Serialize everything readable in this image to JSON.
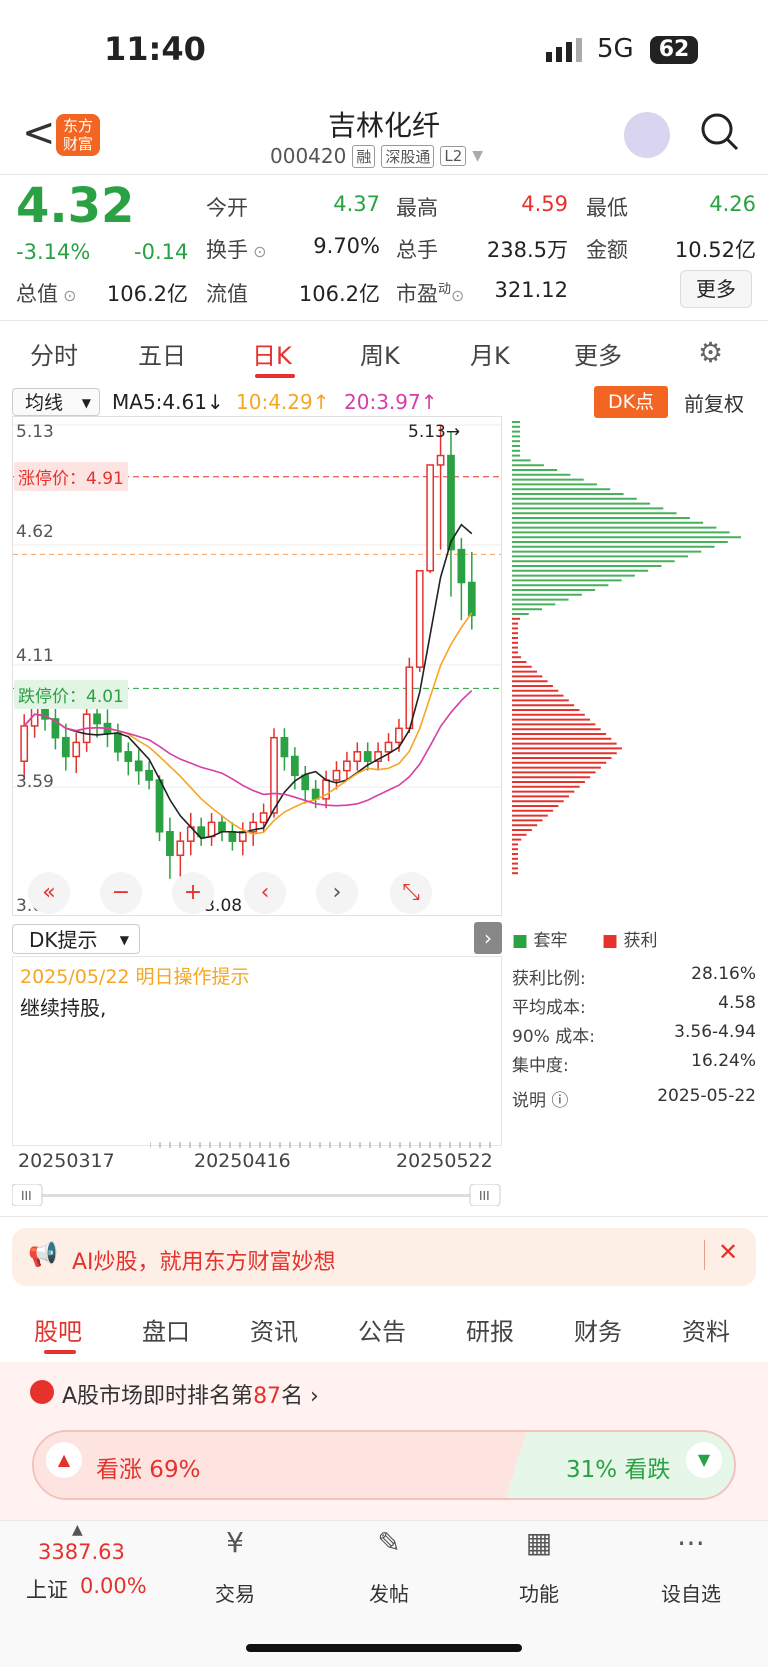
{
  "status": {
    "time": "11:40",
    "network": "5G",
    "battery": "62"
  },
  "header": {
    "back": "<",
    "logo": "东方财富",
    "title": "吉林化纤",
    "code": "000420",
    "tags": [
      "融",
      "深股通",
      "L2"
    ]
  },
  "quote": {
    "price": "4.32",
    "change_pct": "-3.14%",
    "change": "-0.14",
    "fields": [
      {
        "label": "今开",
        "value": "4.37",
        "color": "#2aa142"
      },
      {
        "label": "最高",
        "value": "4.59",
        "color": "#e5322d"
      },
      {
        "label": "最低",
        "value": "4.26",
        "color": "#2aa142"
      },
      {
        "label": "换手",
        "value": "9.70%",
        "color": "#222"
      },
      {
        "label": "总手",
        "value": "238.5万",
        "color": "#222"
      },
      {
        "label": "金额",
        "value": "10.52亿",
        "color": "#222"
      },
      {
        "label": "总值",
        "value": "106.2亿",
        "color": "#222"
      },
      {
        "label": "流值",
        "value": "106.2亿",
        "color": "#222"
      },
      {
        "label": "市盈动",
        "value": "321.12",
        "color": "#222"
      }
    ],
    "more": "更多"
  },
  "ktabs": [
    "分时",
    "五日",
    "日K",
    "周K",
    "月K",
    "更多"
  ],
  "chart_header": {
    "select": "均线",
    "ma5": "MA5:4.61↓",
    "ma10": "10:4.29↑",
    "ma20": "20:3.97↑",
    "dk": "DK点",
    "fq": "前复权"
  },
  "chart_data": {
    "type": "candlestick",
    "y_axis_labels": [
      "5.13",
      "4.62",
      "4.11",
      "3.59",
      "3.08"
    ],
    "limit_up": "涨停价：4.91",
    "limit_down": "跌停价：4.01",
    "high_mark": "5.13→",
    "low_mark": "←3.08",
    "ylim": [
      3.08,
      5.13
    ],
    "x_labels": [
      "20250317",
      "20250416",
      "20250522"
    ],
    "ma": {
      "MA5": 4.61,
      "MA10": 4.29,
      "MA20": 3.97
    },
    "candles": [
      [
        3.7,
        3.85,
        3.62,
        3.9
      ],
      [
        3.85,
        3.95,
        3.8,
        4.02
      ],
      [
        3.95,
        3.88,
        3.83,
        4.0
      ],
      [
        3.88,
        3.8,
        3.75,
        3.93
      ],
      [
        3.8,
        3.72,
        3.66,
        3.86
      ],
      [
        3.72,
        3.78,
        3.65,
        3.82
      ],
      [
        3.78,
        3.9,
        3.74,
        3.98
      ],
      [
        3.9,
        3.86,
        3.8,
        3.96
      ],
      [
        3.86,
        3.82,
        3.76,
        3.92
      ],
      [
        3.82,
        3.74,
        3.7,
        3.86
      ],
      [
        3.74,
        3.7,
        3.64,
        3.78
      ],
      [
        3.7,
        3.66,
        3.6,
        3.75
      ],
      [
        3.66,
        3.62,
        3.58,
        3.7
      ],
      [
        3.62,
        3.4,
        3.36,
        3.64
      ],
      [
        3.4,
        3.3,
        3.2,
        3.46
      ],
      [
        3.3,
        3.36,
        3.08,
        3.4
      ],
      [
        3.36,
        3.42,
        3.3,
        3.48
      ],
      [
        3.42,
        3.38,
        3.34,
        3.46
      ],
      [
        3.38,
        3.44,
        3.34,
        3.48
      ],
      [
        3.44,
        3.4,
        3.36,
        3.47
      ],
      [
        3.4,
        3.36,
        3.32,
        3.44
      ],
      [
        3.36,
        3.4,
        3.3,
        3.44
      ],
      [
        3.4,
        3.44,
        3.34,
        3.48
      ],
      [
        3.44,
        3.48,
        3.4,
        3.52
      ],
      [
        3.48,
        3.8,
        3.46,
        3.84
      ],
      [
        3.8,
        3.72,
        3.66,
        3.84
      ],
      [
        3.72,
        3.64,
        3.58,
        3.76
      ],
      [
        3.64,
        3.58,
        3.52,
        3.68
      ],
      [
        3.58,
        3.54,
        3.5,
        3.62
      ],
      [
        3.54,
        3.62,
        3.5,
        3.66
      ],
      [
        3.62,
        3.66,
        3.58,
        3.7
      ],
      [
        3.66,
        3.7,
        3.62,
        3.74
      ],
      [
        3.7,
        3.74,
        3.66,
        3.78
      ],
      [
        3.74,
        3.7,
        3.66,
        3.78
      ],
      [
        3.7,
        3.74,
        3.66,
        3.78
      ],
      [
        3.74,
        3.78,
        3.7,
        3.82
      ],
      [
        3.78,
        3.84,
        3.74,
        3.88
      ],
      [
        3.84,
        4.1,
        3.82,
        4.14
      ],
      [
        4.1,
        4.51,
        4.08,
        4.51
      ],
      [
        4.51,
        4.96,
        4.5,
        4.96
      ],
      [
        4.96,
        5.0,
        4.6,
        5.13
      ],
      [
        5.0,
        4.6,
        4.4,
        5.1
      ],
      [
        4.6,
        4.46,
        4.3,
        4.65
      ],
      [
        4.46,
        4.32,
        4.26,
        4.59
      ]
    ],
    "chip_legend": [
      "套牢",
      "获利"
    ],
    "chip": {
      "profit_ratio_label": "获利比例:",
      "profit_ratio": "28.16%",
      "avg_cost_label": "平均成本:",
      "avg_cost": "4.58",
      "cost90_label": "90% 成本:",
      "cost90": "3.56-4.94",
      "concentration_label": "集中度:",
      "concentration": "16.24%",
      "note_label": "说明",
      "date": "2025-05-22"
    }
  },
  "dk": {
    "select": "DK提示",
    "date_tip": "2025/05/22 明日操作提示",
    "advice": "继续持股,"
  },
  "ad": {
    "text": "AI炒股，就用东方财富妙想"
  },
  "btabs": [
    "股吧",
    "盘口",
    "资讯",
    "公告",
    "研报",
    "财务",
    "资料"
  ],
  "rank": {
    "prefix": "A股市场即时排名第",
    "num": "87",
    "suffix": "名 ›"
  },
  "vote": {
    "up": "看涨 69%",
    "down": "31% 看跌",
    "up_ratio": 0.69
  },
  "nav": {
    "index_value": "3387.63",
    "index_name": "上证",
    "index_chg": "0.00%",
    "items": [
      "交易",
      "发帖",
      "功能",
      "设自选"
    ]
  }
}
